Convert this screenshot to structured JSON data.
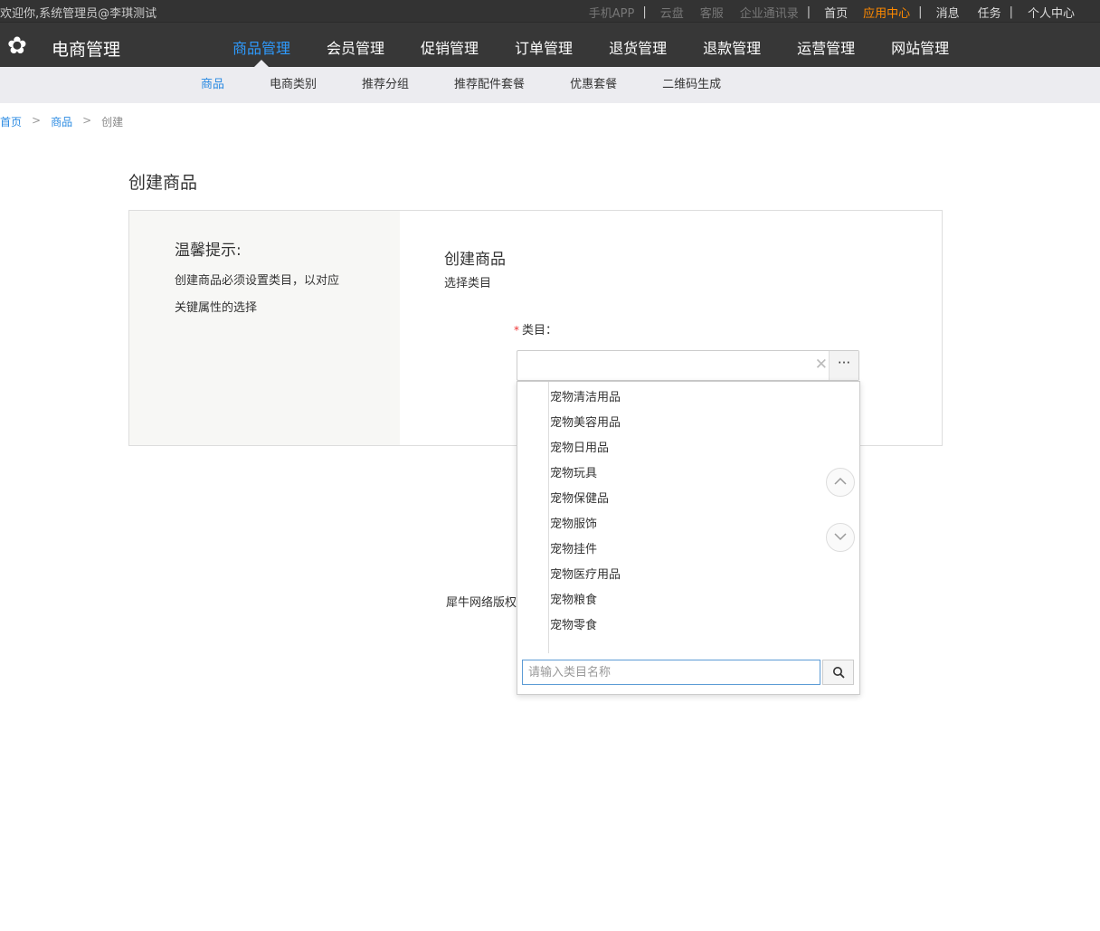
{
  "topbar": {
    "welcome": "欢迎你,系统管理员@李琪测试",
    "links": {
      "mobile_app": "手机APP",
      "cloud": "云盘",
      "service": "客服",
      "contacts": "企业通讯录",
      "home": "首页",
      "app_center": "应用中心",
      "messages": "消息",
      "tasks": "任务",
      "profile": "个人中心"
    },
    "separator": "|"
  },
  "nav": {
    "brand": "电商管理",
    "logo_icon": "flower-icon",
    "items": [
      {
        "label": "商品管理",
        "active": true
      },
      {
        "label": "会员管理"
      },
      {
        "label": "促销管理"
      },
      {
        "label": "订单管理"
      },
      {
        "label": "退货管理"
      },
      {
        "label": "退款管理"
      },
      {
        "label": "运营管理"
      },
      {
        "label": "网站管理"
      }
    ]
  },
  "subnav": {
    "items": [
      {
        "label": "商品",
        "active": true
      },
      {
        "label": "电商类别"
      },
      {
        "label": "推荐分组"
      },
      {
        "label": "推荐配件套餐"
      },
      {
        "label": "优惠套餐"
      },
      {
        "label": "二维码生成"
      }
    ]
  },
  "breadcrumb": {
    "home": "首页",
    "product": "商品",
    "current": "创建",
    "separator": ">"
  },
  "page": {
    "title": "创建商品"
  },
  "tips": {
    "title": "温馨提示:",
    "line1": "创建商品必须设置类目，以对应",
    "line2": "关键属性的选择"
  },
  "form": {
    "title": "创建商品",
    "subtitle": "选择类目",
    "required_mark": "*",
    "category_label": "类目：",
    "clear_symbol": "✕",
    "more_symbol": "···"
  },
  "footer": {
    "text": "犀牛网络版权"
  },
  "dropdown": {
    "options": [
      "宠物清洁用品",
      "宠物美容用品",
      "宠物日用品",
      "宠物玩具",
      "宠物保健品",
      "宠物服饰",
      "宠物挂件",
      "宠物医疗用品",
      "宠物粮食",
      "宠物零食"
    ],
    "search_placeholder": "请输入类目名称"
  },
  "colors": {
    "accent": "#2e9bff",
    "highlight": "#ff8a00",
    "nav_bg": "#373737",
    "subnav_bg": "#ececf0"
  }
}
